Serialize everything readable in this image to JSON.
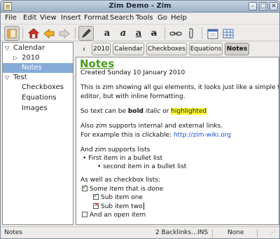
{
  "window": {
    "title": "Zim Demo - Zim"
  },
  "menu": [
    "File",
    "Edit",
    "View",
    "Insert",
    "Format",
    "Search",
    "Tools",
    "Go",
    "Help"
  ],
  "tree": [
    {
      "label": "Calendar",
      "expanded": true
    },
    {
      "label": "2010",
      "expanded": false
    },
    {
      "label": "Notes",
      "selected": true
    },
    {
      "label": "Test",
      "expanded": true
    },
    {
      "label": "Checkboxes"
    },
    {
      "label": "Equations"
    },
    {
      "label": "Images"
    }
  ],
  "pathbar": [
    "2010",
    "Calendar",
    "Checkboxes",
    "Equations",
    "Notes"
  ],
  "page": {
    "heading": "Notes",
    "created": "Created Sunday 10 January 2010",
    "intro_1": "This is zim showing all gui elements, it looks just like a simple text",
    "intro_2": "editor, but with inline formatting.",
    "fmt_pre": "So text can be ",
    "fmt_bold": "bold",
    "fmt_italic": "italic",
    "fmt_or": " or ",
    "fmt_highlight": "highlighted",
    "links_1": "Also zim supports internal and external links.",
    "links_2_pre": "For example this is clickable:  ",
    "link_url": "http://zim-wiki.org",
    "lists_heading": "And zim supports lists",
    "bullet_1": "• First item in a bullet list",
    "bullet_2": "• second item in a bullet list",
    "cb_heading": "As well as checkbox lists:",
    "cb_1": "Some item that is done",
    "cb_2": "Sub item one",
    "cb_3": "Sub item two",
    "cb_4": "And an open item"
  },
  "status": {
    "page": "Notes",
    "backlinks": "2 Backlinks...",
    "mode": "INS",
    "style": "None"
  }
}
